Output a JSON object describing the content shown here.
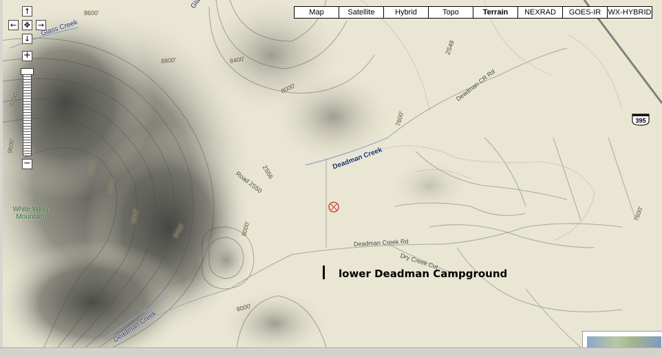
{
  "map_types": [
    "Map",
    "Satellite",
    "Hybrid",
    "Topo",
    "Terrain",
    "NEXRAD",
    "GOES-IR",
    "WX-HYBRID"
  ],
  "active_map_type": "Terrain",
  "pan_controls": {
    "up": "↑",
    "left": "←",
    "center": "✥",
    "right": "→",
    "down": "↓"
  },
  "zoom_controls": {
    "in": "+",
    "out": "−"
  },
  "water_labels": {
    "glass_creek": "Glass Creek",
    "glass_creek_top": "Glass",
    "deadman_creek_upper": "Deadman Creek",
    "deadman_creek_lower": "Deadman Creek"
  },
  "road_labels": {
    "deadman_cr_rd": "Deadman CR Rd",
    "deadman_creek_rd": "Deadman Creek Rd",
    "dry_creek_cut": "Dry Creek Cut",
    "road_2s50": "Road 2S50",
    "r2s56": "2S56",
    "r2s49": "2S49"
  },
  "contour_labels": {
    "c8600_top": "8600'",
    "c8800": "8800'",
    "c8400_top": "8400'",
    "c8000_top": "8000'",
    "c9200_left": "9200'",
    "c9600": "9600'",
    "c9200_mid": "9200'",
    "c9600_mid": "9600'",
    "c8800_mid": "8800'",
    "c8400_mid": "8400'",
    "c8000_mid": "8000'",
    "c7600_top": "7600'",
    "c7600_right": "7600'",
    "c8000_bottom": "8000'"
  },
  "place_labels": {
    "white_wing_mountain": "White Wing\nMountain"
  },
  "highway_shield": "395",
  "annotation": "lower Deadman Campground",
  "colors": {
    "terrain_base": "#e9e6d3",
    "water_label": "#1c2f6b",
    "marker": "#d04a3a"
  }
}
